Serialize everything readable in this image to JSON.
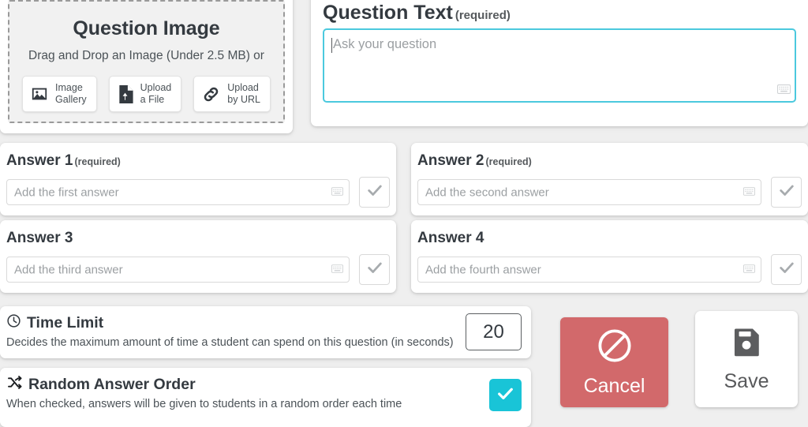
{
  "question_image": {
    "title": "Question Image",
    "instructions": "Drag and Drop an Image (Under 2.5 MB) or",
    "buttons": [
      {
        "label": "Image\nGallery",
        "icon": "image-gallery-icon"
      },
      {
        "label": "Upload\na File",
        "icon": "file-upload-icon"
      },
      {
        "label": "Upload\nby URL",
        "icon": "link-icon"
      }
    ]
  },
  "question_text": {
    "label": "Question Text",
    "required_note": "(required)",
    "placeholder": "Ask your question",
    "value": "",
    "border_color": "#4bc9de"
  },
  "answers": [
    {
      "label": "Answer 1",
      "required_note": "(required)",
      "placeholder": "Add the first answer",
      "value": ""
    },
    {
      "label": "Answer 2",
      "required_note": "(required)",
      "placeholder": "Add the second answer",
      "value": ""
    },
    {
      "label": "Answer 3",
      "required_note": "",
      "placeholder": "Add the third answer",
      "value": ""
    },
    {
      "label": "Answer 4",
      "required_note": "",
      "placeholder": "Add the fourth answer",
      "value": ""
    }
  ],
  "settings": {
    "time_limit": {
      "title": "Time Limit",
      "description": "Decides the maximum amount of time a student can spend on this question (in seconds)",
      "value": "20",
      "icon": "clock-icon"
    },
    "random_answer_order": {
      "title": "Random Answer Order",
      "description": "When checked, answers will be given to students in a random order each time",
      "checked": true,
      "icon": "shuffle-icon",
      "accent_color": "#19c4d7"
    }
  },
  "actions": {
    "cancel": {
      "label": "Cancel",
      "icon": "prohibited-icon",
      "color": "#d2696b"
    },
    "save": {
      "label": "Save",
      "icon": "floppy-disk-icon",
      "color": "#ffffff"
    }
  }
}
